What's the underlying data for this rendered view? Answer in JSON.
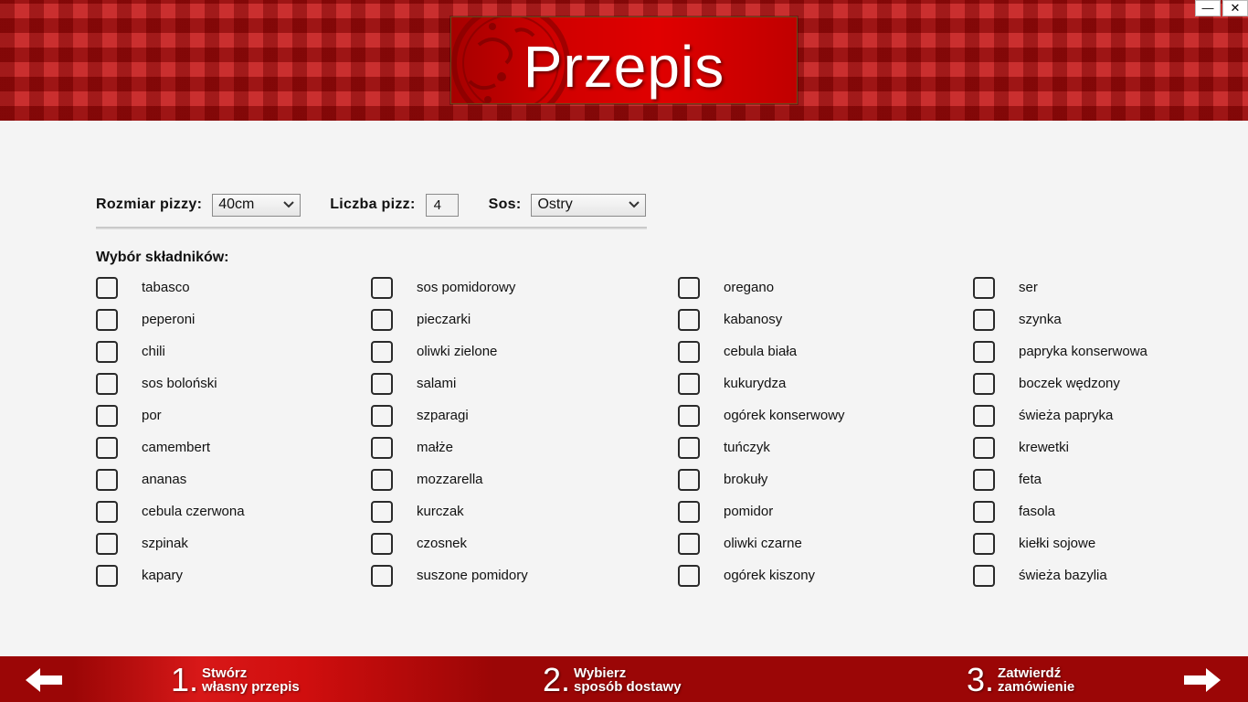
{
  "window": {
    "minimize_label": "—",
    "close_label": "✕"
  },
  "header": {
    "title": "Przepis"
  },
  "options": {
    "size_label": "Rozmiar pizzy:",
    "size_value": "40cm",
    "count_label": "Liczba pizz:",
    "count_value": "4",
    "sauce_label": "Sos:",
    "sauce_value": "Ostry"
  },
  "ingredients_label": "Wybór składników:",
  "ingredients": {
    "col1": [
      "tabasco",
      "peperoni",
      "chili",
      "sos boloński",
      "por",
      "camembert",
      "ananas",
      "cebula czerwona",
      "szpinak",
      "kapary"
    ],
    "col2": [
      "sos pomidorowy",
      "pieczarki",
      "oliwki zielone",
      "salami",
      "szparagi",
      "małże",
      "mozzarella",
      "kurczak",
      "czosnek",
      "suszone pomidory"
    ],
    "col3": [
      "oregano",
      "kabanosy",
      "cebula biała",
      "kukurydza",
      "ogórek konserwowy",
      "tuńczyk",
      "brokuły",
      "pomidor",
      "oliwki czarne",
      "ogórek kiszony"
    ],
    "col4": [
      "ser",
      "szynka",
      "papryka konserwowa",
      "boczek wędzony",
      "świeża papryka",
      "krewetki",
      "feta",
      "fasola",
      "kiełki sojowe",
      "świeża bazylia"
    ]
  },
  "footer": {
    "steps": [
      {
        "num": "1.",
        "line1": "Stwórz",
        "line2": "własny przepis"
      },
      {
        "num": "2.",
        "line1": "Wybierz",
        "line2": "sposób dostawy"
      },
      {
        "num": "3.",
        "line1": "Zatwierdź",
        "line2": "zamówienie"
      }
    ]
  },
  "colors": {
    "brand_red": "#c41414",
    "footer_red": "#9b0606"
  },
  "icons": {
    "back": "arrow-left-icon",
    "next": "arrow-right-icon",
    "dropdown": "chevron-down-icon"
  }
}
